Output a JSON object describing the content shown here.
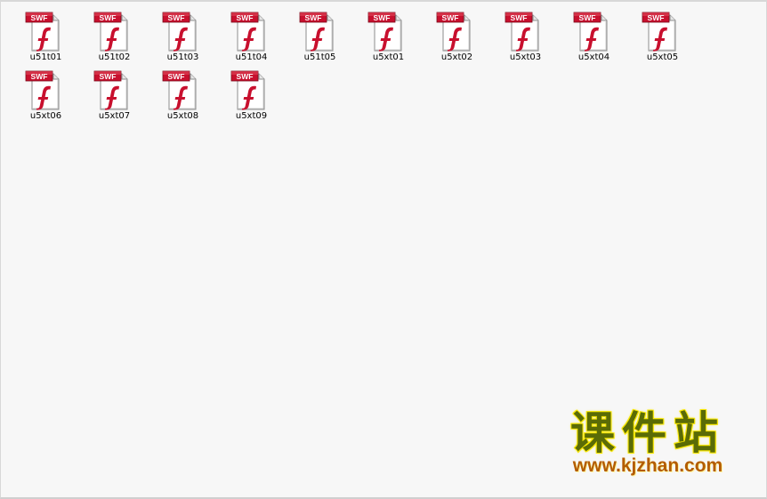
{
  "files": [
    {
      "name": "u51t01",
      "icon": "swf-file-icon",
      "badge": "SWF"
    },
    {
      "name": "u51t02",
      "icon": "swf-file-icon",
      "badge": "SWF"
    },
    {
      "name": "u51t03",
      "icon": "swf-file-icon",
      "badge": "SWF"
    },
    {
      "name": "u51t04",
      "icon": "swf-file-icon",
      "badge": "SWF"
    },
    {
      "name": "u51t05",
      "icon": "swf-file-icon",
      "badge": "SWF"
    },
    {
      "name": "u5xt01",
      "icon": "swf-file-icon",
      "badge": "SWF"
    },
    {
      "name": "u5xt02",
      "icon": "swf-file-icon",
      "badge": "SWF"
    },
    {
      "name": "u5xt03",
      "icon": "swf-file-icon",
      "badge": "SWF"
    },
    {
      "name": "u5xt04",
      "icon": "swf-file-icon",
      "badge": "SWF"
    },
    {
      "name": "u5xt05",
      "icon": "swf-file-icon",
      "badge": "SWF"
    },
    {
      "name": "u5xt06",
      "icon": "swf-file-icon",
      "badge": "SWF"
    },
    {
      "name": "u5xt07",
      "icon": "swf-file-icon",
      "badge": "SWF"
    },
    {
      "name": "u5xt08",
      "icon": "swf-file-icon",
      "badge": "SWF"
    },
    {
      "name": "u5xt09",
      "icon": "swf-file-icon",
      "badge": "SWF"
    }
  ],
  "watermark": {
    "title": "课件站",
    "url": "www.kjzhan.com"
  },
  "colors": {
    "background": "#f7f7f7",
    "swf_red": "#c8102e",
    "watermark_green": "#5a6b06",
    "watermark_yellow": "#f7e600",
    "watermark_orange": "#b35c00"
  }
}
